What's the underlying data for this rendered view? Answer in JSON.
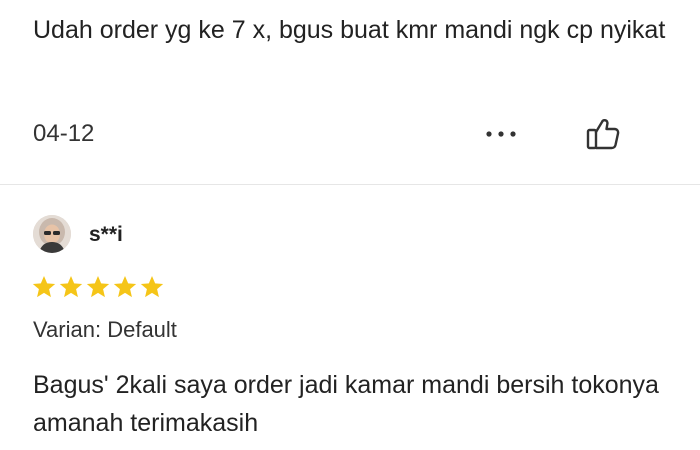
{
  "reviews": [
    {
      "text": "Udah order yg ke 7 x, bgus buat kmr mandi ngk cp nyikat",
      "date": "04-12",
      "more_icon": "ellipsis-icon",
      "like_icon": "thumbs-up-icon"
    },
    {
      "username": "s**i",
      "avatar_icon": "user-avatar",
      "rating": 5,
      "rating_max": 5,
      "star_color": "#f5c518",
      "variant_label": "Varian:",
      "variant_value": "Default",
      "text": "Bagus' 2kali saya order jadi kamar mandi bersih tokonya amanah terimakasih"
    }
  ]
}
